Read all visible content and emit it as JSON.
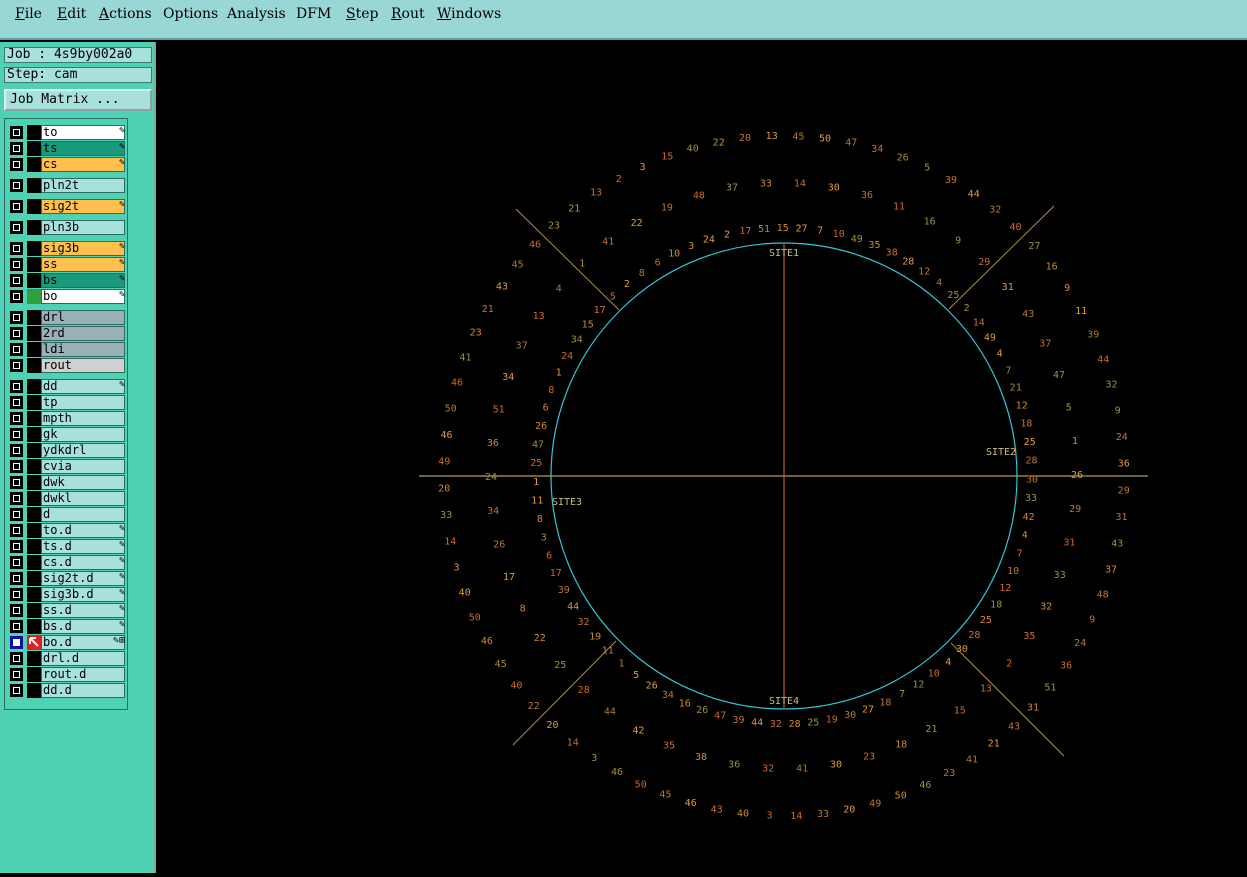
{
  "menu": {
    "items": [
      {
        "label": "File",
        "accel": "F"
      },
      {
        "label": "Edit",
        "accel": "E"
      },
      {
        "label": "Actions",
        "accel": "A"
      },
      {
        "label": "Options",
        "accel": ""
      },
      {
        "label": "Analysis",
        "accel": ""
      },
      {
        "label": "DFM",
        "accel": ""
      },
      {
        "label": "Step",
        "accel": "S"
      },
      {
        "label": "Rout",
        "accel": "R"
      },
      {
        "label": "Windows",
        "accel": "W"
      }
    ]
  },
  "job": {
    "job_line": "Job : 4s9by002a0",
    "step_line": "Step: cam",
    "matrix_button": "Job Matrix ..."
  },
  "layers": [
    {
      "name": "to",
      "color": "#ffffff",
      "mark": "✎",
      "group": 1
    },
    {
      "name": "ts",
      "color": "#1a9a7a",
      "mark": "✎",
      "group": 1
    },
    {
      "name": "cs",
      "color": "#ffc050",
      "mark": "✎",
      "group": 1
    },
    {
      "name": "pln2t",
      "color": "#a8e0dc",
      "mark": "",
      "group": 2
    },
    {
      "name": "sig2t",
      "color": "#ffc050",
      "mark": "✎",
      "group": 3
    },
    {
      "name": "pln3b",
      "color": "#a8e0dc",
      "mark": "",
      "group": 4
    },
    {
      "name": "sig3b",
      "color": "#ffc050",
      "mark": "✎",
      "group": 5
    },
    {
      "name": "ss",
      "color": "#ffc050",
      "mark": "✎",
      "group": 5
    },
    {
      "name": "bs",
      "color": "#1a9a7a",
      "mark": "✎",
      "group": 5
    },
    {
      "name": "bo",
      "color": "#ffffff",
      "mark": "✎",
      "group": 5,
      "swatch": "green"
    },
    {
      "name": "drl",
      "color": "#9ab0b8",
      "mark": "",
      "group": 6
    },
    {
      "name": "2rd",
      "color": "#9ab0b8",
      "mark": "",
      "group": 6
    },
    {
      "name": "ldi",
      "color": "#9ab0b8",
      "mark": "",
      "group": 6
    },
    {
      "name": "rout",
      "color": "#d0d0d0",
      "mark": "",
      "group": 6
    },
    {
      "name": "dd",
      "color": "#a8e0dc",
      "mark": "✎",
      "group": 7
    },
    {
      "name": "tp",
      "color": "#a8e0dc",
      "mark": "",
      "group": 7
    },
    {
      "name": "mpth",
      "color": "#a8e0dc",
      "mark": "",
      "group": 7
    },
    {
      "name": "gk",
      "color": "#a8e0dc",
      "mark": "",
      "group": 7
    },
    {
      "name": "ydkdrl",
      "color": "#a8e0dc",
      "mark": "",
      "group": 7
    },
    {
      "name": "cvia",
      "color": "#a8e0dc",
      "mark": "",
      "group": 7
    },
    {
      "name": "dwk",
      "color": "#a8e0dc",
      "mark": "",
      "group": 7
    },
    {
      "name": "dwkl",
      "color": "#a8e0dc",
      "mark": "",
      "group": 7
    },
    {
      "name": "d",
      "color": "#a8e0dc",
      "mark": "",
      "group": 7
    },
    {
      "name": "to.d",
      "color": "#a8e0dc",
      "mark": "✎",
      "group": 7
    },
    {
      "name": "ts.d",
      "color": "#a8e0dc",
      "mark": "✎",
      "group": 7
    },
    {
      "name": "cs.d",
      "color": "#a8e0dc",
      "mark": "✎",
      "group": 7
    },
    {
      "name": "sig2t.d",
      "color": "#a8e0dc",
      "mark": "✎",
      "group": 7
    },
    {
      "name": "sig3b.d",
      "color": "#a8e0dc",
      "mark": "✎",
      "group": 7
    },
    {
      "name": "ss.d",
      "color": "#a8e0dc",
      "mark": "✎",
      "group": 7
    },
    {
      "name": "bs.d",
      "color": "#a8e0dc",
      "mark": "✎",
      "group": 7
    },
    {
      "name": "bo.d",
      "color": "#a8e0dc",
      "mark": "✎⊞",
      "group": 7,
      "selected": true,
      "swatch": "arrow"
    },
    {
      "name": "drl.d",
      "color": "#a8e0dc",
      "mark": "",
      "group": 7
    },
    {
      "name": "rout.d",
      "color": "#a8e0dc",
      "mark": "",
      "group": 7
    },
    {
      "name": "dd.d",
      "color": "#a8e0dc",
      "mark": "",
      "group": 7
    }
  ],
  "canvas": {
    "site_labels": [
      "SITE1",
      "SITE2",
      "SITE3",
      "SITE4"
    ],
    "ring_outer": [
      "50",
      "47",
      "34",
      "26",
      "5",
      "39",
      "44",
      "32",
      "40",
      "27",
      "16",
      "9",
      "11",
      "39",
      "44",
      "32",
      "9",
      "24",
      "36",
      "29",
      "31",
      "43",
      "37",
      "48",
      "9",
      "24",
      "36",
      "51",
      "31",
      "43",
      "21",
      "41",
      "23",
      "46",
      "50",
      "49",
      "20",
      "33",
      "14",
      "3",
      "40",
      "43",
      "46",
      "45",
      "50",
      "46",
      "3",
      "14",
      "20",
      "22",
      "40",
      "45",
      "46",
      "50",
      "40",
      "3",
      "14",
      "33",
      "20",
      "49",
      "46",
      "50",
      "46",
      "41",
      "23",
      "21",
      "43",
      "45",
      "46",
      "23",
      "21",
      "13",
      "2",
      "3",
      "15",
      "40",
      "22",
      "20",
      "13",
      "45"
    ],
    "ring_middle": [
      "30",
      "36",
      "11",
      "16",
      "9",
      "29",
      "31",
      "43",
      "37",
      "47",
      "5",
      "1",
      "26",
      "29",
      "31",
      "33",
      "32",
      "35",
      "2",
      "13",
      "15",
      "21",
      "18",
      "23",
      "30",
      "41",
      "32",
      "36",
      "38",
      "35",
      "42",
      "44",
      "28",
      "25",
      "22",
      "8",
      "17",
      "26",
      "34",
      "24",
      "36",
      "51",
      "34",
      "37",
      "13",
      "4",
      "1",
      "41",
      "22",
      "19",
      "48",
      "37",
      "33",
      "14"
    ],
    "ring_inner": [
      "27",
      "7",
      "10",
      "49",
      "35",
      "38",
      "28",
      "12",
      "4",
      "25",
      "2",
      "14",
      "49",
      "4",
      "7",
      "21",
      "12",
      "18",
      "25",
      "28",
      "30",
      "33",
      "42",
      "4",
      "7",
      "10",
      "12",
      "18",
      "25",
      "28",
      "30",
      "4",
      "10",
      "12",
      "7",
      "18",
      "27",
      "30",
      "19",
      "25",
      "28",
      "32",
      "44",
      "39",
      "47",
      "26",
      "16",
      "34",
      "26",
      "5",
      "1",
      "11",
      "19",
      "32",
      "44",
      "39",
      "17",
      "6",
      "3",
      "8",
      "11",
      "1",
      "25",
      "47",
      "26",
      "6",
      "8",
      "1",
      "24",
      "34",
      "15",
      "17",
      "5",
      "2",
      "8",
      "6",
      "10",
      "3",
      "24",
      "2",
      "17",
      "51",
      "15"
    ]
  }
}
